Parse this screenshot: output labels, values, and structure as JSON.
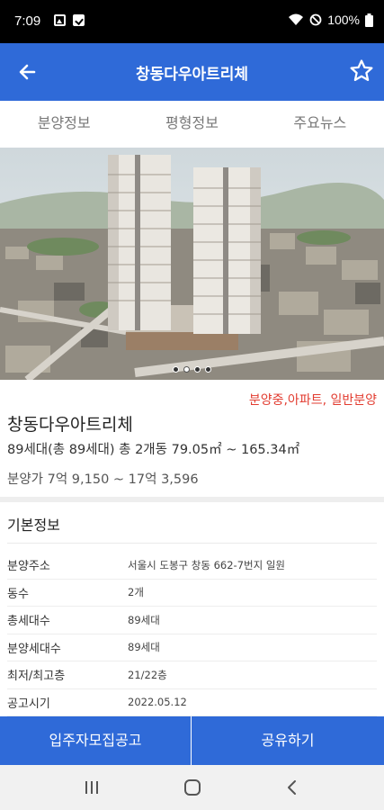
{
  "status_bar": {
    "time": "7:09",
    "battery": "100%",
    "icons": [
      "image-icon",
      "check-icon",
      "wifi-icon",
      "dnd-icon",
      "battery-icon"
    ]
  },
  "app_bar": {
    "title": "창동다우아트리체",
    "back_icon": "arrow-back-icon",
    "favorite_icon": "star-outline-icon",
    "color": "#2f6ad8"
  },
  "tabs": [
    {
      "label": "분양정보"
    },
    {
      "label": "평형정보"
    },
    {
      "label": "주요뉴스"
    }
  ],
  "carousel": {
    "image_desc": "apartment-rendering",
    "dots": 4,
    "active_index": 1
  },
  "summary": {
    "tags": "분양중,아파트, 일반분양",
    "name": "창동다우아트리체",
    "units": "89세대(총 89세대) 총 2개동  79.05㎡ ~ 165.34㎡",
    "price": "분양가 7억 9,150 ~ 17억 3,596",
    "tag_color": "#e23b2f"
  },
  "basic_info": {
    "title": "기본정보",
    "rows": [
      {
        "key": "분양주소",
        "value": "서울시 도봉구 창동 662-7번지 일원"
      },
      {
        "key": "동수",
        "value": "2개"
      },
      {
        "key": "총세대수",
        "value": "89세대"
      },
      {
        "key": "분양세대수",
        "value": "89세대"
      },
      {
        "key": "최저/최고층",
        "value": "21/22층"
      },
      {
        "key": "공고시기",
        "value": "2022.05.12"
      }
    ]
  },
  "actions": {
    "left": "입주자모집공고",
    "right": "공유하기"
  },
  "nav_bar": {
    "icons": [
      "recent-apps-icon",
      "home-icon",
      "back-icon"
    ]
  }
}
